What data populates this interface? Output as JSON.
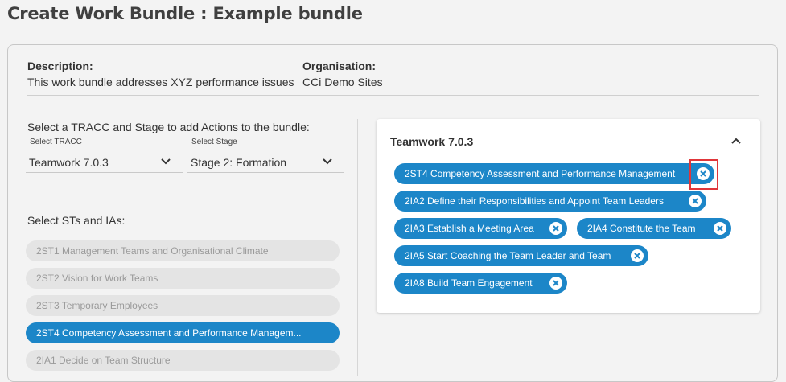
{
  "page": {
    "title": "Create Work Bundle : Example bundle"
  },
  "details": {
    "description_label": "Description:",
    "description_value": "This work bundle addresses XYZ performance issues",
    "organisation_label": "Organisation:",
    "organisation_value": "CCi Demo Sites"
  },
  "selector": {
    "instruction": "Select a TRACC and Stage to add Actions to the bundle:",
    "tracc_label": "Select TRACC",
    "tracc_value": "Teamwork 7.0.3",
    "stage_label": "Select Stage",
    "stage_value": "Stage 2: Formation",
    "list_heading": "Select STs and IAs:",
    "items": [
      {
        "label": "2ST1 Management Teams and Organisational Climate",
        "selected": false
      },
      {
        "label": "2ST2 Vision for Work Teams",
        "selected": false
      },
      {
        "label": "2ST3 Temporary Employees",
        "selected": false
      },
      {
        "label": "2ST4 Competency Assessment and Performance Managem...",
        "selected": true
      },
      {
        "label": "2IA1 Decide on Team Structure",
        "selected": false
      }
    ]
  },
  "bundle": {
    "title": "Teamwork 7.0.3",
    "chips": [
      {
        "label": "2ST4 Competency Assessment and Performance Management"
      },
      {
        "label": "2IA2 Define their Responsibilities and Appoint Team Leaders"
      },
      {
        "label": "2IA3 Establish a Meeting Area"
      },
      {
        "label": "2IA4 Constitute the Team"
      },
      {
        "label": "2IA5 Start Coaching the Team Leader and Team"
      },
      {
        "label": "2IA8 Build Team Engagement"
      }
    ]
  },
  "icons": {
    "chevron_down": "chevron-down-icon",
    "chevron_up": "chevron-up-icon",
    "remove": "close-circle-icon"
  },
  "colors": {
    "accent": "#1c86c8",
    "disabled_item_bg": "#e4e4e4",
    "disabled_item_text": "#9a9a9a",
    "highlight": "#e0363a"
  }
}
